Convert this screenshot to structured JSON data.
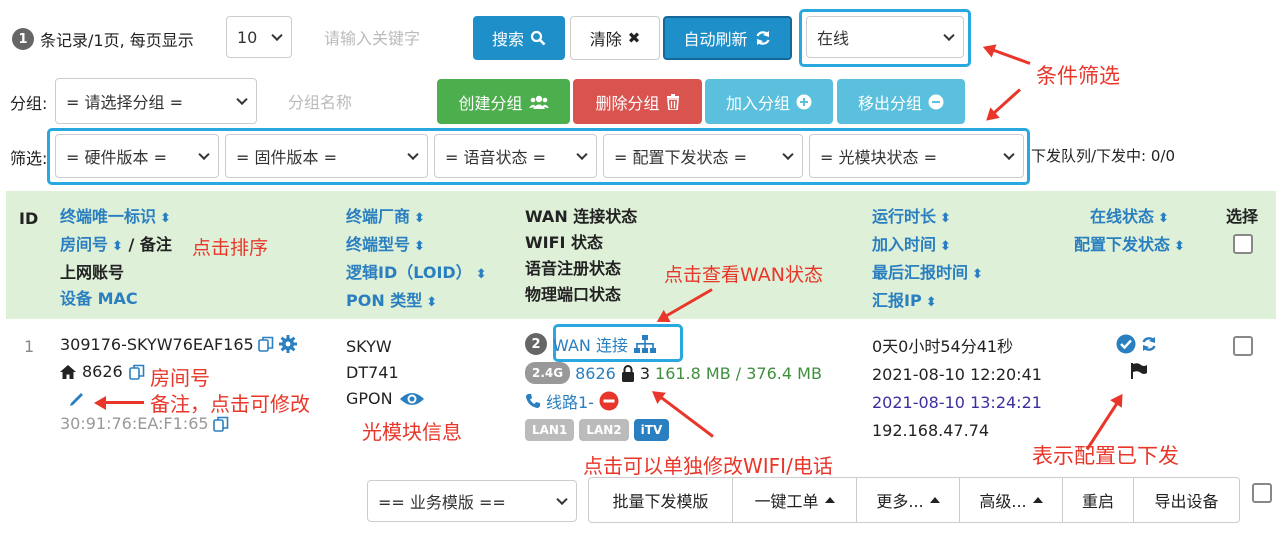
{
  "toolbar": {
    "records_badge": "1",
    "records_text": "条记录/1页, 每页显示",
    "page_size": "10",
    "search_placeholder": "请输入关键字",
    "search_label": "搜索",
    "clear_label": "清除",
    "auto_refresh_label": "自动刷新",
    "status_filter": "在线"
  },
  "group": {
    "label": "分组:",
    "select": "= 请选择分组 =",
    "name_placeholder": "分组名称",
    "create": "创建分组",
    "delete": "删除分组",
    "join": "加入分组",
    "remove": "移出分组"
  },
  "filter": {
    "label": "筛选:",
    "hardware": "= 硬件版本 =",
    "firmware": "= 固件版本 =",
    "voice": "= 语音状态 =",
    "config": "= 配置下发状态 =",
    "optical": "= 光模块状态 =",
    "queue": "下发队列/下发中: 0/0"
  },
  "table": {
    "headers": {
      "id": "ID",
      "c1": [
        "终端唯一标识",
        "房间号",
        "/ 备注",
        "上网账号",
        "设备 MAC"
      ],
      "c2": [
        "终端厂商",
        "终端型号",
        "逻辑ID（LOID）",
        "PON 类型"
      ],
      "c3": [
        "WAN 连接状态",
        "WIFI 状态",
        "语音注册状态",
        "物理端口状态"
      ],
      "c4": [
        "运行时长",
        "加入时间",
        "最后汇报时间",
        "汇报IP"
      ],
      "c5": [
        "在线状态",
        "配置下发状态"
      ],
      "select": "选择"
    },
    "row": {
      "id": "1",
      "uid": "309176-SKYW76EAF165",
      "room": "8626",
      "mac": "30:91:76:EA:F1:65",
      "vendor": "SKYW",
      "model": "DT741",
      "pon": "GPON",
      "wan_badge": "2",
      "wan_label": "WAN 连接",
      "wifi_band": "2.4G",
      "wifi_ssid": "8626",
      "wifi_clients": "3",
      "wifi_traffic": "161.8 MB / 376.4 MB",
      "voice_line": "线路1-",
      "ports": [
        "LAN1",
        "LAN2",
        "iTV"
      ],
      "uptime": "0天0小时54分41秒",
      "join_time": "2021-08-10 12:20:41",
      "last_report": "2021-08-10 13:24:21",
      "report_ip": "192.168.47.74"
    }
  },
  "bottom": {
    "template_select": "== 业务模版 ==",
    "batch": "批量下发模版",
    "one_click": "一键工单",
    "more": "更多...",
    "advanced": "高级...",
    "reboot": "重启",
    "export": "导出设备"
  },
  "annotations": {
    "condition": "条件筛选",
    "sort": "点击排序",
    "wan": "点击查看WAN状态",
    "room": "房间号",
    "remark": "备注，点击可修改",
    "optical": "光模块信息",
    "wifi_phone": "点击可以单独修改WIFI/电话",
    "config": "表示配置已下发"
  },
  "colors": {
    "primary": "#1f8fc9",
    "green": "#4cae4c",
    "red": "#d9534f",
    "light_blue": "#5bc0de",
    "header_bg": "#dff0d8",
    "annotation": "#e8372a",
    "highlight": "#29a8e0"
  }
}
